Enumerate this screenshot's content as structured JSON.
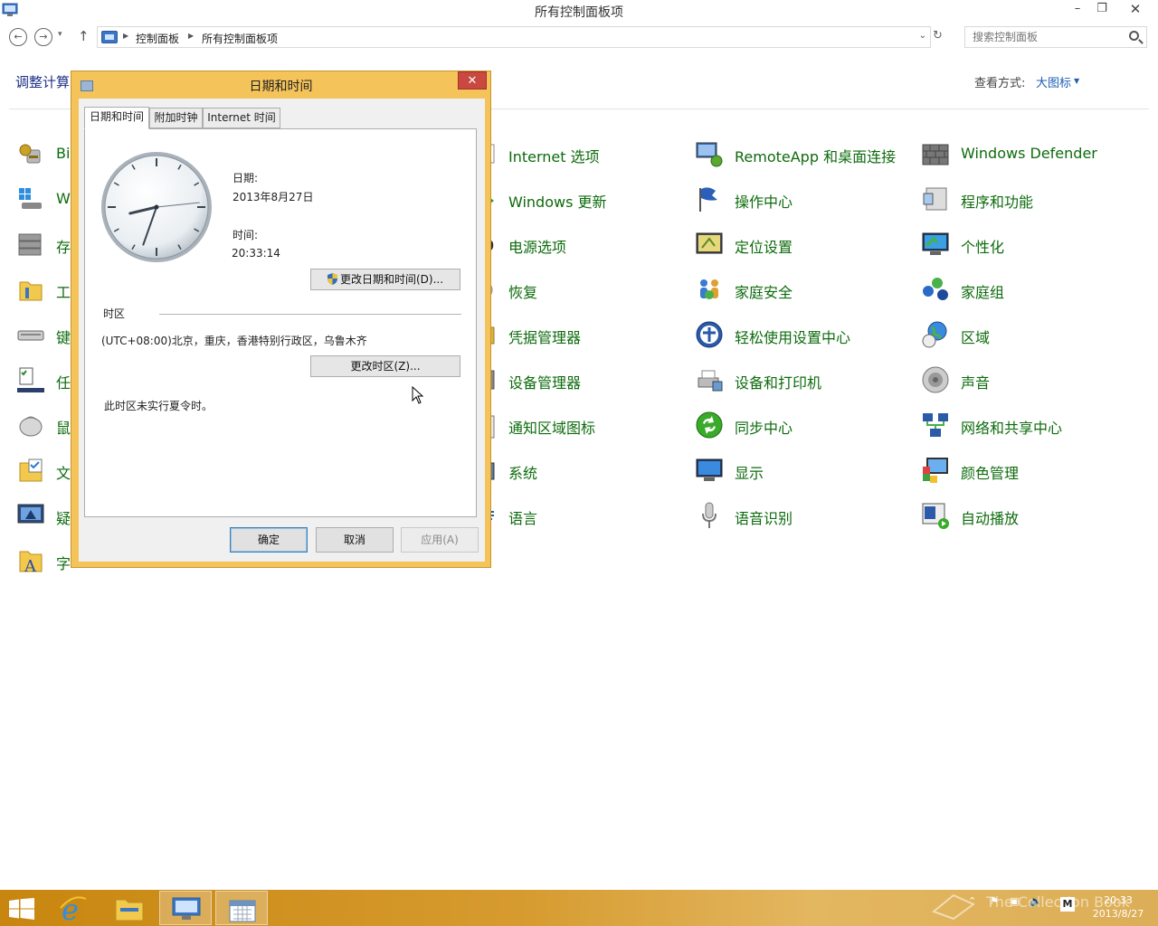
{
  "window": {
    "title": "所有控制面板项",
    "minimize": "–",
    "maximize": "❐",
    "close": "✕"
  },
  "nav": {
    "back": "←",
    "forward": "→",
    "history_dropdown": "▾",
    "up": "↑",
    "breadcrumbs": [
      "控制面板",
      "所有控制面板项"
    ],
    "refresh": "↻",
    "search_placeholder": "搜索控制面板"
  },
  "page": {
    "heading": "调整计算",
    "view_by_label": "查看方式:",
    "view_by_value": "大图标",
    "view_by_caret": "▼"
  },
  "items": {
    "left_col": [
      "Bi",
      "W",
      "存",
      "工",
      "键",
      "任",
      "鼠",
      "文",
      "疑",
      "字"
    ],
    "col2": [
      "Internet 选项",
      "Windows 更新",
      "电源选项",
      "恢复",
      "凭据管理器",
      "设备管理器",
      "通知区域图标",
      "系统",
      "语言"
    ],
    "col3": [
      "RemoteApp 和桌面连接",
      "操作中心",
      "定位设置",
      "家庭安全",
      "轻松使用设置中心",
      "设备和打印机",
      "同步中心",
      "显示",
      "语音识别"
    ],
    "col4": [
      "Windows Defender",
      "程序和功能",
      "个性化",
      "家庭组",
      "区域",
      "声音",
      "网络和共享中心",
      "颜色管理",
      "自动播放"
    ]
  },
  "dialog": {
    "title": "日期和时间",
    "close": "✕",
    "tabs": [
      "日期和时间",
      "附加时钟",
      "Internet 时间"
    ],
    "date_label": "日期:",
    "date_value": "2013年8月27日",
    "time_label": "时间:",
    "time_value": "20:33:14",
    "change_datetime_button": "更改日期和时间(D)...",
    "timezone_header": "时区",
    "timezone_value": "(UTC+08:00)北京，重庆，香港特别行政区，乌鲁木齐",
    "change_timezone_button": "更改时区(Z)...",
    "dst_note": "此时区未实行夏令时。",
    "ok": "确定",
    "cancel": "取消",
    "apply": "应用(A)",
    "clock": {
      "hours": 20,
      "minutes": 33,
      "seconds": 14
    }
  },
  "taskbar": {
    "clock_time": "20:33",
    "clock_date": "2013/8/27",
    "watermark": "The Collection Book",
    "ime": "M"
  },
  "colors": {
    "accent_gold": "#f4c35a",
    "link_green": "#0d6b0d",
    "heading_blue": "#1e3287"
  }
}
